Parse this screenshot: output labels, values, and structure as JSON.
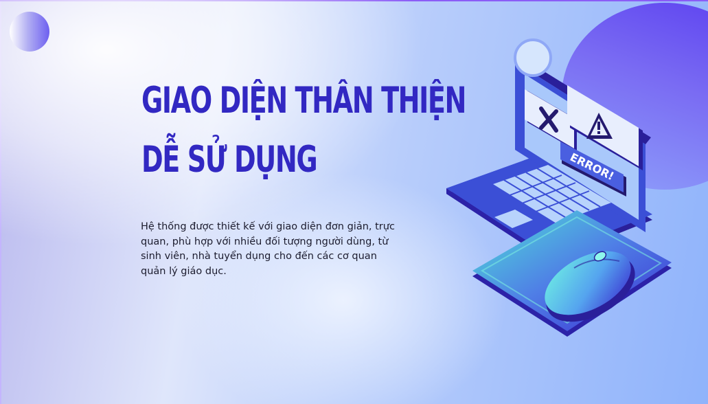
{
  "slide": {
    "title_lines": [
      "GIAO DIỆN THÂN THIỆN",
      "DỄ SỬ DỤNG"
    ],
    "description": "Hệ thống được thiết kế với giao diện đơn giản, trực quan, phù hợp với nhiều đối tượng người dùng, từ sinh viên, nhà tuyển dụng cho đến các cơ quan quản lý giáo dục."
  },
  "illustration": {
    "error_label": "ERROR!",
    "icons": [
      "laptop-icon",
      "close-x-icon",
      "warning-icon",
      "mouse-icon"
    ]
  },
  "colors": {
    "title": "#3228c2",
    "laptop": "#3b4fd6",
    "accent_blob": "#5b3ff0",
    "mousepad": "#4b3fd8",
    "mouse": "#4fe3d8"
  }
}
